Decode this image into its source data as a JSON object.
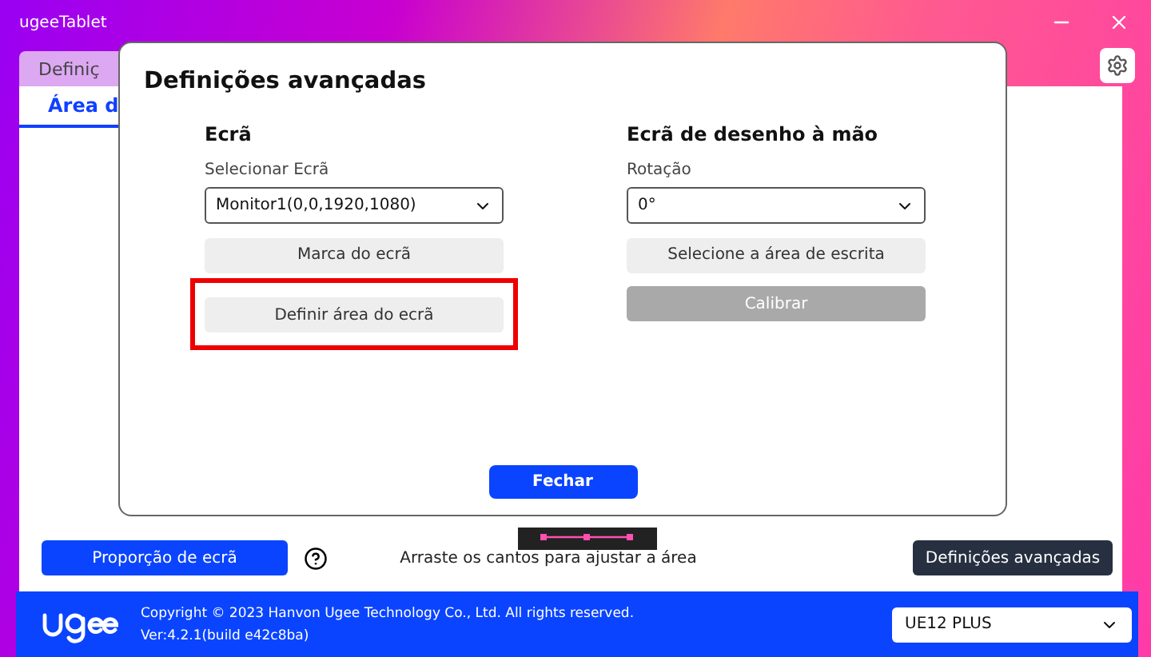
{
  "window": {
    "title": "ugeeTablet"
  },
  "header": {
    "tab": {
      "label": "Definiç",
      "selected": true
    }
  },
  "panel": {
    "tab": {
      "label": "Área d",
      "selected": true
    },
    "ratio_button": "Proporção de ecrã",
    "hint": "Arraste os cantos para ajustar a área",
    "advanced_button": "Definições avançadas"
  },
  "footer": {
    "copyright": "Copyright © 2023 Hanvon Ugee Technology Co., Ltd. All rights reserved.",
    "version": "Ver:4.2.1(build e42c8ba)",
    "device": "UE12 PLUS"
  },
  "dialog": {
    "title": "Definições avançadas",
    "columns": [
      {
        "heading": "Ecrã",
        "field_label": "Selecionar Ecrã",
        "select": "Monitor1(0,0,1920,1080)",
        "buttons": [
          {
            "label": "Marca do ecrã",
            "disabled": false,
            "highlighted": false
          },
          {
            "label": "Definir área do ecrã",
            "disabled": false,
            "highlighted": true
          }
        ]
      },
      {
        "heading": "Ecrã de desenho à mão",
        "field_label": "Rotação",
        "select": "0°",
        "buttons": [
          {
            "label": "Selecione a área de escrita",
            "disabled": false,
            "highlighted": false
          },
          {
            "label": "Calibrar",
            "disabled": true,
            "highlighted": false
          }
        ]
      }
    ],
    "close_button": "Fechar"
  }
}
